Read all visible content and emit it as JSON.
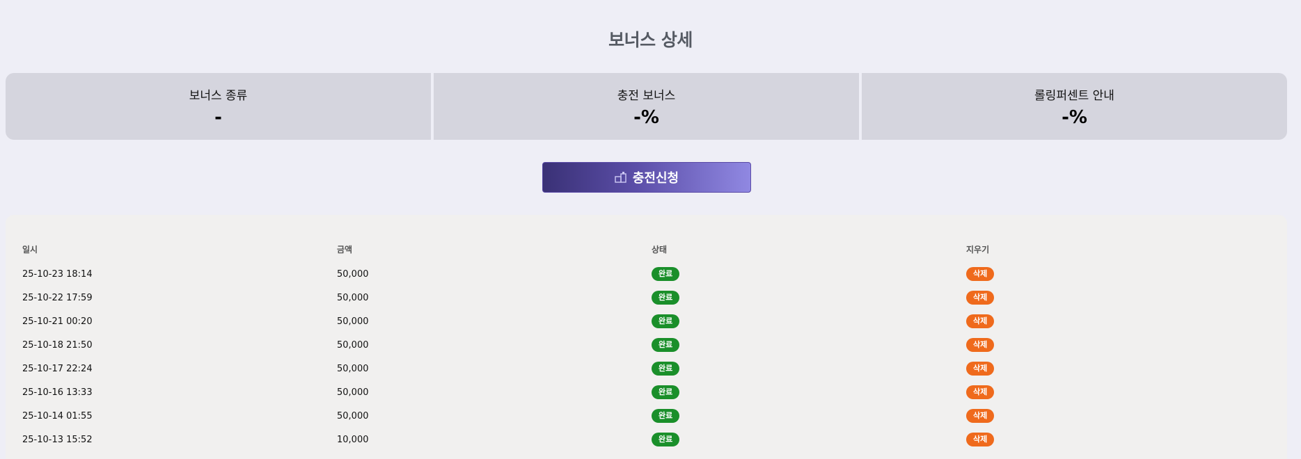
{
  "page_title": "보너스 상세",
  "cards": [
    {
      "label": "보너스 종류",
      "value": "-"
    },
    {
      "label": "충전 보너스",
      "value": "-%"
    },
    {
      "label": "롤링퍼센트 안내",
      "value": "-%"
    }
  ],
  "charge_button": {
    "label": "충전신청",
    "icon": "gift-icon"
  },
  "table": {
    "headers": {
      "date": "일시",
      "amount": "금액",
      "status": "상태",
      "delete": "지우기"
    },
    "rows": [
      {
        "date": "25-10-23 18:14",
        "amount": "50,000",
        "status": "완료",
        "delete": "삭제"
      },
      {
        "date": "25-10-22 17:59",
        "amount": "50,000",
        "status": "완료",
        "delete": "삭제"
      },
      {
        "date": "25-10-21 00:20",
        "amount": "50,000",
        "status": "완료",
        "delete": "삭제"
      },
      {
        "date": "25-10-18 21:50",
        "amount": "50,000",
        "status": "완료",
        "delete": "삭제"
      },
      {
        "date": "25-10-17 22:24",
        "amount": "50,000",
        "status": "완료",
        "delete": "삭제"
      },
      {
        "date": "25-10-16 13:33",
        "amount": "50,000",
        "status": "완료",
        "delete": "삭제"
      },
      {
        "date": "25-10-14 01:55",
        "amount": "50,000",
        "status": "완료",
        "delete": "삭제"
      },
      {
        "date": "25-10-13 15:52",
        "amount": "10,000",
        "status": "완료",
        "delete": "삭제"
      }
    ]
  },
  "colors": {
    "background": "#eeeef6",
    "card_bg": "#d5d5de",
    "button_gradient_start": "#3a3176",
    "button_gradient_end": "#9088e2",
    "status_done": "#1a8f2a",
    "delete_badge": "#ef6a1c"
  }
}
